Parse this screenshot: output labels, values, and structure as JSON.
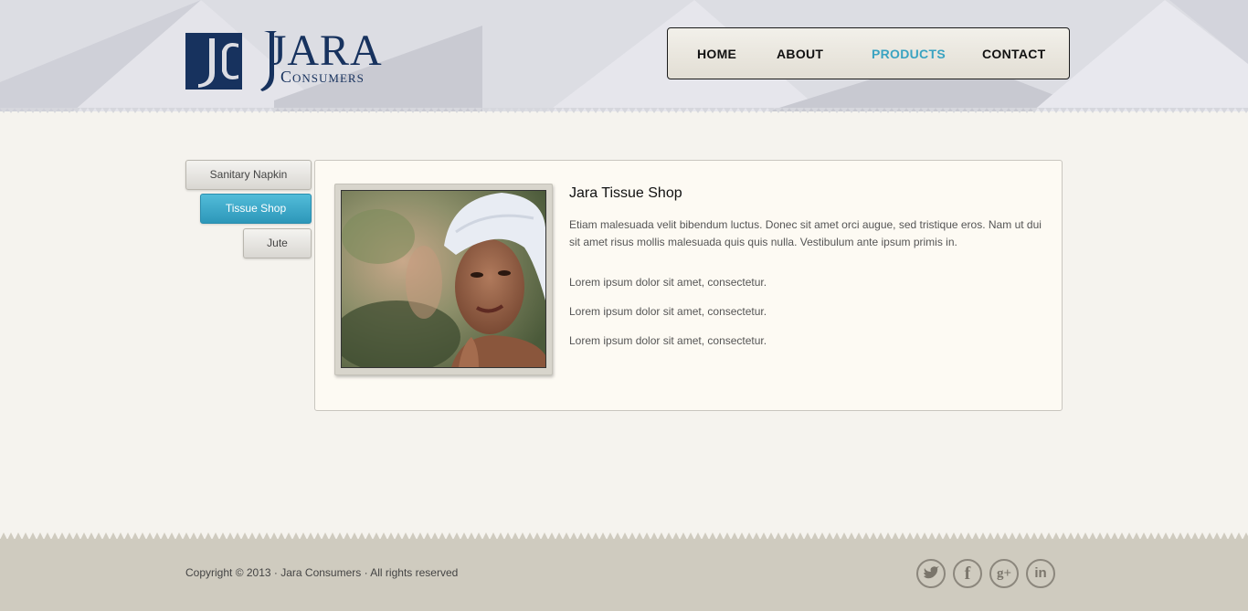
{
  "brand": {
    "name": "JARA",
    "subtitle": "Consumers"
  },
  "nav": {
    "items": [
      {
        "label": "HOME"
      },
      {
        "label": "ABOUT"
      },
      {
        "label": "PRODUCTS",
        "active": true
      },
      {
        "label": "CONTACT"
      }
    ],
    "active_color": "#3aa3c1"
  },
  "sidebar": {
    "items": [
      {
        "label": "Sanitary Napkin"
      },
      {
        "label": "Tissue Shop",
        "active": true
      },
      {
        "label": "Jute"
      }
    ]
  },
  "main": {
    "title": "Jara Tissue Shop",
    "paragraph": "Etiam malesuada velit bibendum luctus. Donec sit amet orci augue, sed tristique eros. Nam ut dui sit amet risus mollis malesuada quis quis nulla. Vestibulum ante ipsum primis in.",
    "list": [
      "Lorem ipsum dolor sit amet, consectetur.",
      "Lorem ipsum dolor sit amet, consectetur.",
      "Lorem ipsum dolor sit amet, consectetur."
    ]
  },
  "footer": {
    "copyright": "Copyright © 2013 · Jara Consumers · All rights reserved",
    "social": [
      {
        "icon": "twitter-icon"
      },
      {
        "icon": "facebook-icon"
      },
      {
        "icon": "google-plus-icon"
      },
      {
        "icon": "linkedin-icon"
      }
    ]
  },
  "colors": {
    "brand_navy": "#17325e",
    "accent": "#3aa3c1"
  }
}
